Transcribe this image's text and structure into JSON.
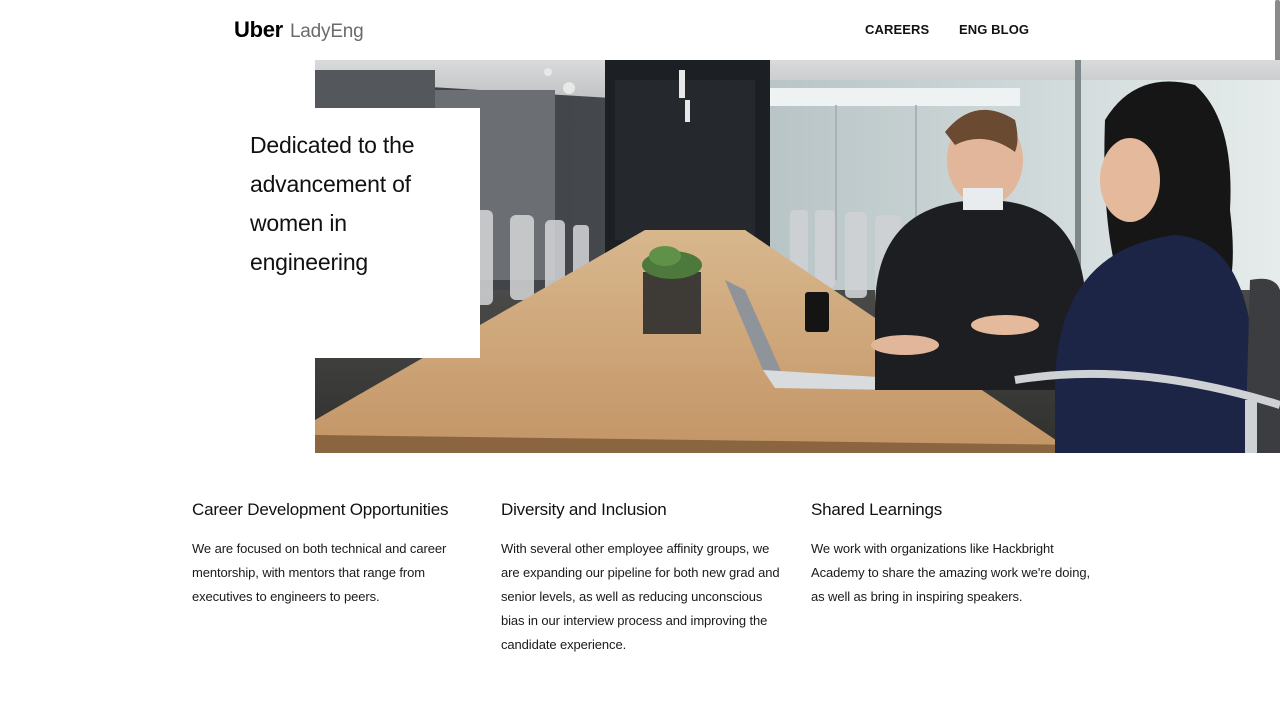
{
  "header": {
    "logo_main": "Uber",
    "logo_sub": "LadyEng",
    "nav": [
      {
        "label": "CAREERS"
      },
      {
        "label": "ENG BLOG"
      }
    ]
  },
  "hero": {
    "tagline": "Dedicated to the advancement of women in engineering"
  },
  "features": [
    {
      "title": "Career Development Opportunities",
      "body": "We are focused on both technical and career mentorship, with mentors that range from executives to engineers to peers."
    },
    {
      "title": "Diversity and Inclusion",
      "body": "With several other employee affinity groups, we are expanding our pipeline for both new grad and senior levels, as well as reducing unconscious bias in our interview process and improving the candidate experience."
    },
    {
      "title": "Shared Learnings",
      "body": "We work with organizations like Hackbright Academy to share the amazing work we're doing, as well as bring in inspiring speakers."
    }
  ]
}
